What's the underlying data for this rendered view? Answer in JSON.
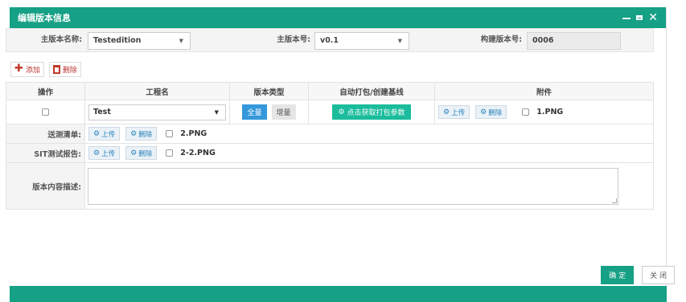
{
  "dialog": {
    "title": "编辑版本信息"
  },
  "form": {
    "main_version_name_label": "主版本名称:",
    "main_version_name_value": "Testedition",
    "main_version_no_label": "主版本号:",
    "main_version_no_value": "v0.1",
    "build_version_label": "构建版本号:",
    "build_version_value": "0006"
  },
  "toolbar": {
    "add_label": "添加",
    "delete_label": "删除"
  },
  "table": {
    "headers": [
      "操作",
      "工程名",
      "版本类型",
      "自动打包/创建基线",
      "附件"
    ],
    "row": {
      "project": "Test",
      "type_full": "全量",
      "type_incr": "增量",
      "get_params": "点击获取打包参数",
      "upload": "上传",
      "delete": "删除",
      "file": "1.PNG"
    }
  },
  "send_list": {
    "label": "送测清单:",
    "upload": "上传",
    "delete": "删除",
    "file": "2.PNG"
  },
  "sit_report": {
    "label": "SIT测试报告:",
    "upload": "上传",
    "delete": "删除",
    "file": "2-2.PNG"
  },
  "description": {
    "label": "版本内容描述:"
  },
  "footer": {
    "ok": "确 定",
    "close": "关 闭"
  }
}
